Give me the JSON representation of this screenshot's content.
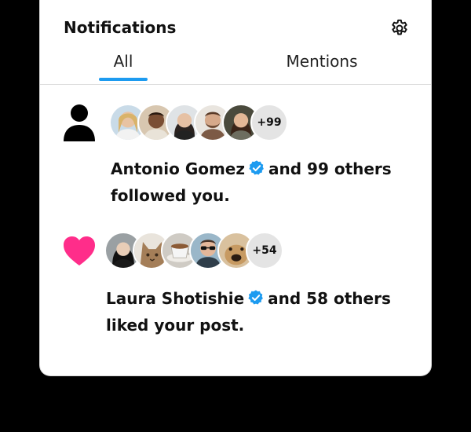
{
  "header": {
    "title": "Notifications"
  },
  "tabs": [
    {
      "label": "All",
      "active": true
    },
    {
      "label": "Mentions",
      "active": false
    }
  ],
  "notifications": [
    {
      "type": "follow",
      "icon": "person-icon",
      "avatar_icons": [
        "avatar-woman-blonde",
        "avatar-man-smiling",
        "avatar-woman-dark-hair",
        "avatar-man-beard",
        "avatar-woman-brunette"
      ],
      "more_count": "+99",
      "actor": "Antonio Gomez",
      "rest_line1": "and 99 others",
      "rest_line2": "followed you."
    },
    {
      "type": "like",
      "icon": "heart-icon",
      "avatar_icons": [
        "avatar-woman-black-hair",
        "avatar-cat",
        "avatar-coffee-cup",
        "avatar-man-sunglasses",
        "avatar-dog"
      ],
      "more_count": "+54",
      "actor": "Laura Shotishie",
      "rest_line1": "and 58 others",
      "rest_line2": "liked your post."
    }
  ],
  "colors": {
    "accent": "#1d9bf0",
    "heart": "#ff2d8a",
    "verified": "#1d9bf0",
    "background": "#000000",
    "card": "#ffffff"
  }
}
